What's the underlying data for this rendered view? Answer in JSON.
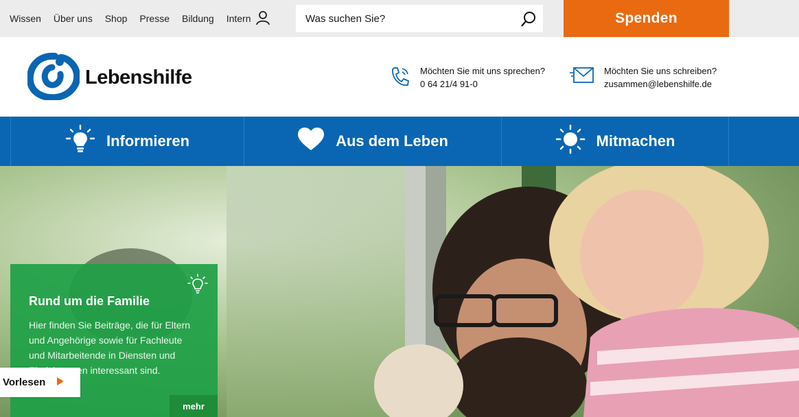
{
  "util_nav": {
    "items": [
      "Wissen",
      "Über uns",
      "Shop",
      "Presse",
      "Bildung"
    ],
    "intern_label": "Intern"
  },
  "search": {
    "placeholder": "Was suchen Sie?"
  },
  "donate": {
    "label": "Spenden"
  },
  "logo": {
    "text": "Lebenshilfe"
  },
  "contact": {
    "phone": {
      "question": "Möchten Sie mit uns sprechen?",
      "value": "0 64 21/4 91-0"
    },
    "mail": {
      "question": "Möchten Sie uns schreiben?",
      "value": "zusammen@lebenshilfe.de"
    }
  },
  "main_nav": [
    "Informieren",
    "Aus dem Leben",
    "Mitmachen"
  ],
  "teaser": {
    "title": "Rund um die Familie",
    "text": "Hier finden Sie Beiträge, die für Eltern und Angehörige sowie für Fachleute und Mitarbeitende in Diensten und Einrichtungen interessant sind.",
    "more_label": "mehr"
  },
  "read_aloud": {
    "label": "Vorlesen"
  },
  "colors": {
    "brand_blue": "#0a66b2",
    "donate_orange": "#ea6a12",
    "teaser_green": "#1ea046"
  }
}
